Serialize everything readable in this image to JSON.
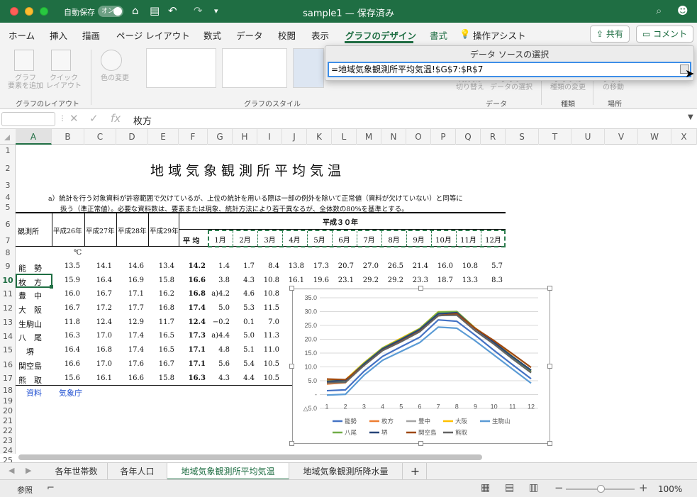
{
  "title_bar": {
    "autosave_label": "自動保存",
    "autosave_state": "オン",
    "document_title": "sample1 — 保存済み"
  },
  "ribbon_tabs": [
    "ホーム",
    "挿入",
    "描画",
    "ページ レイアウト",
    "数式",
    "データ",
    "校閲",
    "表示",
    "グラフのデザイン",
    "書式",
    "操作アシスト"
  ],
  "active_tab": "グラフのデザイン",
  "share_button": "共有",
  "comment_button": "コメント",
  "ribbon": {
    "add_element": "グラフ\n要素を追加",
    "quick_layout": "クイック\nレイアウト",
    "change_color": "色の変更",
    "switch_row_col": "行/列の\n切り替え",
    "select_data": "グラフ\nデータの選択",
    "change_type": "グラフの\n種類の変更",
    "move_chart": "グラフ\nの移動",
    "groups": {
      "layout": "グラフのレイアウト",
      "styles": "グラフのスタイル",
      "data": "データ",
      "type": "種類",
      "location": "場所"
    }
  },
  "dialog": {
    "title": "データ ソースの選択",
    "input_value": "=地域気象観測所平均気温!$G$7:$R$7"
  },
  "formula_bar": {
    "content": "枚方"
  },
  "columns": [
    "A",
    "B",
    "C",
    "D",
    "E",
    "F",
    "G",
    "H",
    "I",
    "J",
    "K",
    "L",
    "M",
    "N",
    "O",
    "P",
    "Q",
    "R",
    "S",
    "T",
    "U",
    "V",
    "W",
    "X"
  ],
  "rows": [
    "1",
    "2",
    "3",
    "4",
    "5",
    "6",
    "7",
    "8",
    "9",
    "10",
    "11",
    "12",
    "13",
    "14",
    "15",
    "16",
    "17",
    "18",
    "19",
    "20",
    "21",
    "22",
    "23",
    "24",
    "25"
  ],
  "sheet": {
    "title": "地域気象観測所平均気温",
    "note_line1": "a）統計を行う対象資料が許容範囲で欠けているが、上位の統計を用いる際は一部の例外を除いて正常値（資料が欠けていない）と同等に",
    "note_line2": "扱う（準正常値）。必要な資料数は、要素または現象、統計方法により若干異なるが、全体数の80%を基準とする。",
    "header_station": "観測所",
    "header_years": [
      "平成26年",
      "平成27年",
      "平成28年",
      "平成29年"
    ],
    "header_h30": "平成３０年",
    "header_avg": "平 均",
    "months": [
      "1月",
      "2月",
      "3月",
      "4月",
      "5月",
      "6月",
      "7月",
      "8月",
      "9月",
      "10月",
      "11月",
      "12月"
    ],
    "unit": "℃",
    "stations": [
      {
        "name": "能　勢",
        "years": [
          "13.5",
          "14.1",
          "14.6",
          "13.4"
        ],
        "avg": "14.2",
        "m": [
          "1.4",
          "1.7",
          "8.4",
          "13.8",
          "17.3",
          "20.7",
          "27.0",
          "26.5",
          "21.4",
          "16.0",
          "10.8",
          "5.7"
        ]
      },
      {
        "name": "枚　方",
        "years": [
          "15.9",
          "16.4",
          "16.9",
          "15.8"
        ],
        "avg": "16.6",
        "m": [
          "3.8",
          "4.3",
          "10.8",
          "16.1",
          "19.6",
          "23.1",
          "29.2",
          "29.2",
          "23.3",
          "18.7",
          "13.3",
          "8.3"
        ]
      },
      {
        "name": "豊　中",
        "years": [
          "16.0",
          "16.7",
          "17.1",
          "16.2"
        ],
        "avg": "16.8",
        "m": [
          "a)4.2",
          "4.6",
          "10.8"
        ]
      },
      {
        "name": "大　阪",
        "years": [
          "16.7",
          "17.2",
          "17.7",
          "16.8"
        ],
        "avg": "17.4",
        "m": [
          "5.0",
          "5.3",
          "11.5"
        ]
      },
      {
        "name": "生駒山",
        "years": [
          "11.8",
          "12.4",
          "12.9",
          "11.7"
        ],
        "avg": "12.4",
        "m": [
          "−0.2",
          "0.1",
          "7.0"
        ]
      },
      {
        "name": "八　尾",
        "years": [
          "16.3",
          "17.0",
          "17.4",
          "16.5"
        ],
        "avg": "17.3",
        "m": [
          "a)4.4",
          "5.0",
          "11.3"
        ]
      },
      {
        "name": "　堺",
        "years": [
          "16.4",
          "16.8",
          "17.4",
          "16.5"
        ],
        "avg": "17.1",
        "m": [
          "4.8",
          "5.1",
          "11.0"
        ]
      },
      {
        "name": "関空島",
        "years": [
          "16.6",
          "17.0",
          "17.6",
          "16.7"
        ],
        "avg": "17.1",
        "m": [
          "5.6",
          "5.4",
          "10.5"
        ]
      },
      {
        "name": "熊　取",
        "years": [
          "15.6",
          "16.1",
          "16.6",
          "15.8"
        ],
        "avg": "16.3",
        "m": [
          "4.3",
          "4.4",
          "10.5"
        ]
      }
    ],
    "source_label": "資料",
    "source_value": "気象庁"
  },
  "chart_data": {
    "type": "line",
    "categories": [
      "1",
      "2",
      "3",
      "4",
      "5",
      "6",
      "7",
      "8",
      "9",
      "10",
      "11",
      "12"
    ],
    "y_tick_labels": [
      "35.0",
      "30.0",
      "25.0",
      "20.0",
      "15.0",
      "10.0",
      "5.0",
      "-",
      "△5.0"
    ],
    "ylim": [
      -5,
      35
    ],
    "grid": true,
    "legend_position": "bottom",
    "series": [
      {
        "name": "能勢",
        "color": "#4472c4",
        "values": [
          1.4,
          1.7,
          8.4,
          13.8,
          17.3,
          20.7,
          27.0,
          26.5,
          21.4,
          16.0,
          10.8,
          5.7
        ]
      },
      {
        "name": "枚方",
        "color": "#ed7d31",
        "values": [
          3.8,
          4.3,
          10.8,
          16.1,
          19.6,
          23.1,
          29.2,
          29.2,
          23.3,
          18.7,
          13.3,
          8.3
        ]
      },
      {
        "name": "豊中",
        "color": "#a5a5a5",
        "values": [
          4.2,
          4.6,
          10.8,
          16.3,
          19.9,
          23.4,
          29.4,
          29.5,
          23.4,
          18.5,
          13.1,
          8.0
        ]
      },
      {
        "name": "大阪",
        "color": "#ffc000",
        "values": [
          5.0,
          5.3,
          11.5,
          16.9,
          20.4,
          23.9,
          29.9,
          30.0,
          24.0,
          19.2,
          13.8,
          8.8
        ]
      },
      {
        "name": "生駒山",
        "color": "#5b9bd5",
        "values": [
          -0.2,
          0.1,
          7.0,
          12.4,
          15.6,
          18.8,
          24.4,
          24.0,
          19.4,
          14.3,
          9.2,
          4.1
        ]
      },
      {
        "name": "八尾",
        "color": "#70ad47",
        "values": [
          4.4,
          5.0,
          11.3,
          16.8,
          20.1,
          23.8,
          29.8,
          30.0,
          23.9,
          18.9,
          13.4,
          8.4
        ]
      },
      {
        "name": "堺",
        "color": "#264478",
        "values": [
          4.8,
          5.1,
          11.0,
          16.5,
          19.9,
          23.5,
          29.2,
          29.6,
          23.8,
          18.9,
          13.7,
          8.8
        ]
      },
      {
        "name": "関空島",
        "color": "#9e480e",
        "values": [
          5.6,
          5.4,
          10.5,
          16.0,
          19.3,
          22.9,
          28.5,
          29.2,
          23.9,
          19.5,
          14.7,
          9.8
        ]
      },
      {
        "name": "熊取",
        "color": "#636363",
        "values": [
          4.3,
          4.4,
          10.5,
          15.9,
          19.1,
          22.7,
          28.6,
          28.7,
          23.0,
          18.2,
          12.9,
          7.9
        ]
      }
    ]
  },
  "sheet_tabs": [
    "各年世帯数",
    "各年人口",
    "地域気象観測所平均気温",
    "地域気象観測所降水量"
  ],
  "active_sheet": "地域気象観測所平均気温",
  "status": {
    "mode": "参照",
    "zoom": "100%",
    "zoom_level_pct": 100
  }
}
